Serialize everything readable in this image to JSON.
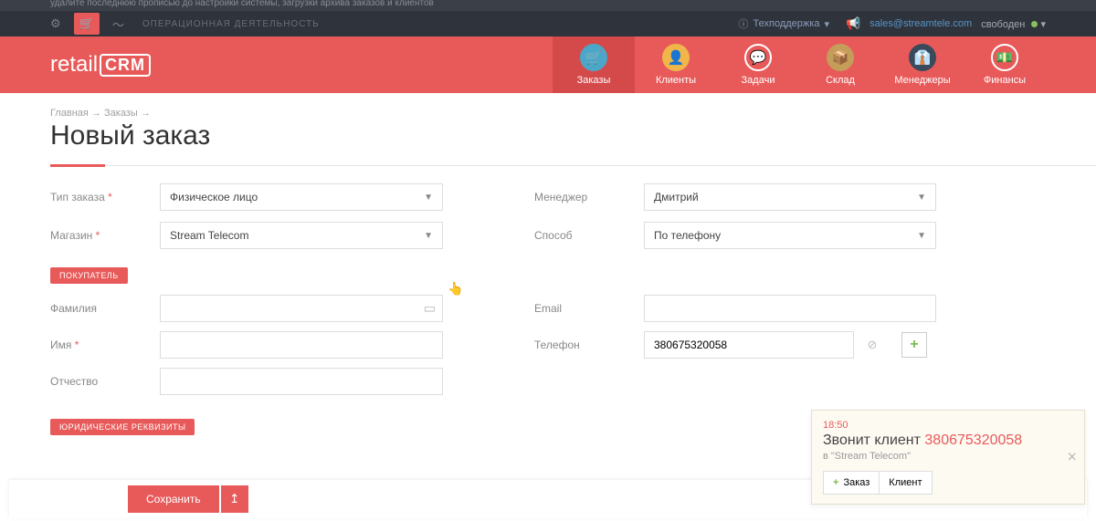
{
  "topbar": {
    "faded_text": "удалите последнюю прописью до настройки системы, загрузки архива заказов и клиентов",
    "activity_label": "ОПЕРАЦИОННАЯ ДЕЯТЕЛЬНОСТЬ",
    "support": "Техподдержка",
    "user_email": "sales@streamtele.com",
    "user_status": "свободен"
  },
  "logo": {
    "brand1": "retail",
    "brand2": "CRM"
  },
  "nav": [
    {
      "label": "Заказы",
      "icon_color": "#4aa7c8",
      "active": true
    },
    {
      "label": "Клиенты",
      "icon_color": "#f0b64a",
      "active": false
    },
    {
      "label": "Задачи",
      "icon_color": "#e85a5a",
      "active": false
    },
    {
      "label": "Склад",
      "icon_color": "#c59d5a",
      "active": false
    },
    {
      "label": "Менеджеры",
      "icon_color": "#3a4a5a",
      "active": false
    },
    {
      "label": "Финансы",
      "icon_color": "#e85a5a",
      "active": false
    }
  ],
  "breadcrumb": {
    "home": "Главная",
    "orders": "Заказы"
  },
  "page_title": "Новый заказ",
  "form": {
    "order_type_label": "Тип заказа",
    "order_type_value": "Физическое лицо",
    "shop_label": "Магазин",
    "shop_value": "Stream Telecom",
    "manager_label": "Менеджер",
    "manager_value": "Дмитрий",
    "method_label": "Способ",
    "method_value": "По телефону"
  },
  "sections": {
    "buyer": "ПОКУПАТЕЛЬ",
    "legal": "ЮРИДИЧЕСКИЕ РЕКВИЗИТЫ"
  },
  "buyer": {
    "lastname_label": "Фамилия",
    "firstname_label": "Имя",
    "middlename_label": "Отчество",
    "email_label": "Email",
    "phone_label": "Телефон",
    "phone_value": "380675320058"
  },
  "save": {
    "label": "Сохранить"
  },
  "popup": {
    "time": "18:50",
    "title_text": "Звонит клиент",
    "number": "380675320058",
    "sub": "в \"Stream Telecom\"",
    "order_btn": "Заказ",
    "client_btn": "Клиент"
  }
}
